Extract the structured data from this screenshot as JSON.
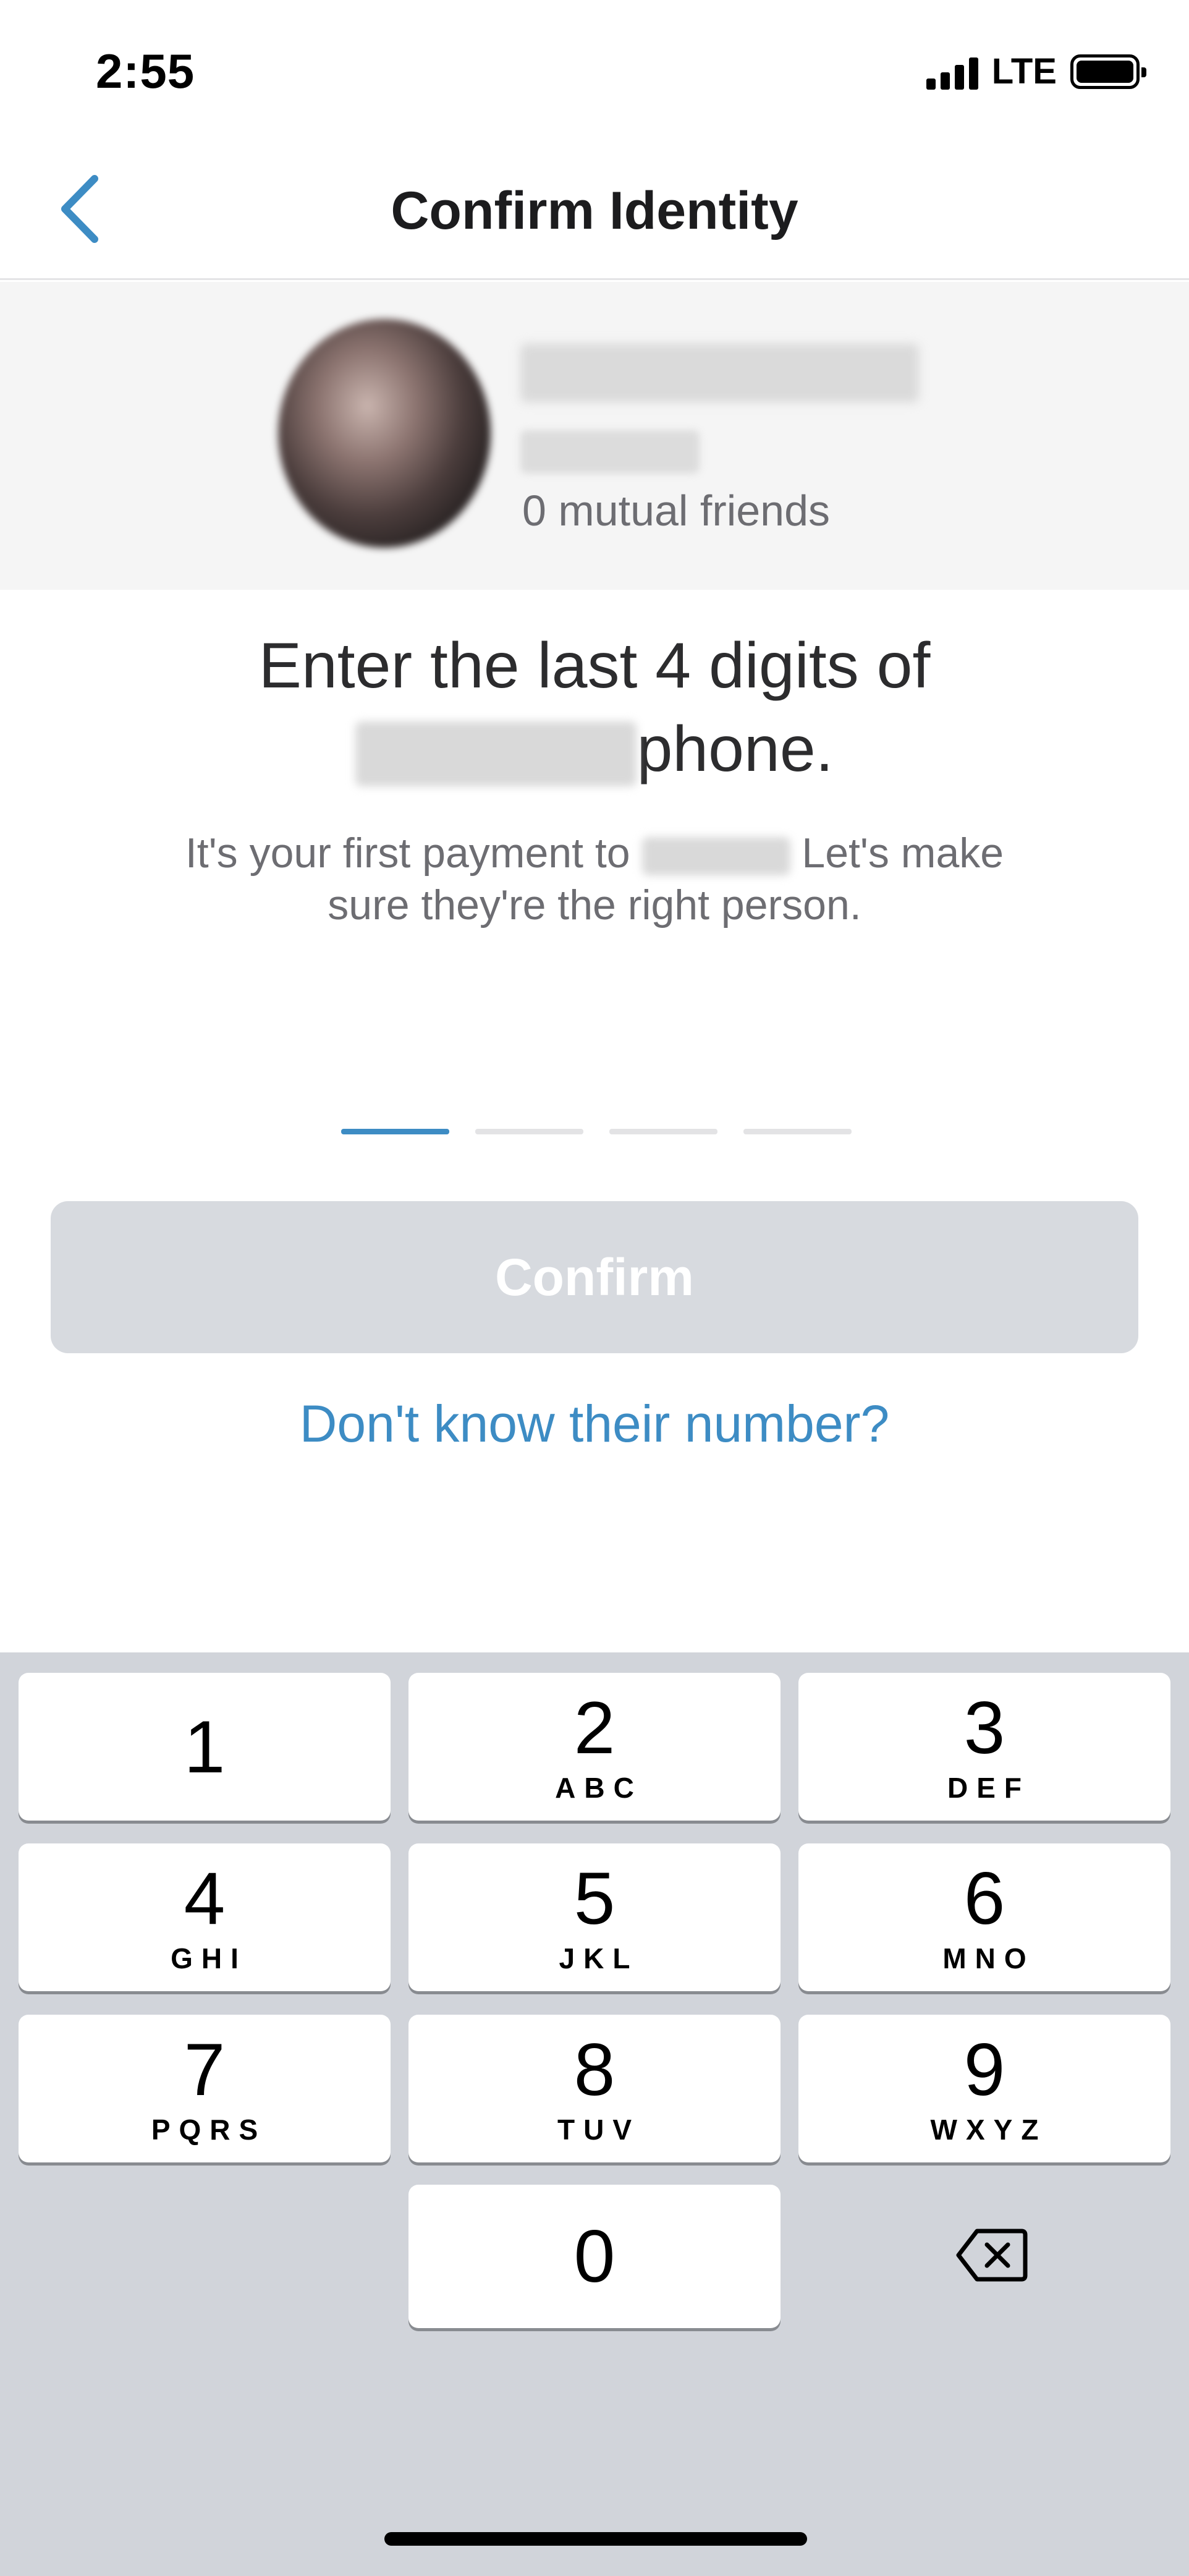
{
  "status": {
    "time": "2:55",
    "network": "LTE"
  },
  "nav": {
    "title": "Confirm Identity",
    "back_icon": "chevron-left-icon"
  },
  "recipient": {
    "mutual_friends": "0 mutual friends"
  },
  "prompt": {
    "heading_line1": "Enter the last 4 digits of",
    "heading_line2_suffix": "phone.",
    "sub_line1_prefix": "It's your first payment to",
    "sub_line1_suffix": "Let's make",
    "sub_line2": "sure they're the right person."
  },
  "pin": {
    "length": 4,
    "active_index": 0
  },
  "confirm": {
    "label": "Confirm"
  },
  "help_link": {
    "label": "Don't know their number?"
  },
  "keypad": [
    {
      "digit": "1",
      "letters": ""
    },
    {
      "digit": "2",
      "letters": "ABC"
    },
    {
      "digit": "3",
      "letters": "DEF"
    },
    {
      "digit": "4",
      "letters": "GHI"
    },
    {
      "digit": "5",
      "letters": "JKL"
    },
    {
      "digit": "6",
      "letters": "MNO"
    },
    {
      "digit": "7",
      "letters": "PQRS"
    },
    {
      "digit": "8",
      "letters": "TUV"
    },
    {
      "digit": "9",
      "letters": "WXYZ"
    },
    {
      "digit": "0",
      "letters": ""
    }
  ],
  "colors": {
    "accent": "#3d8cc4",
    "button_disabled": "#d7dadf",
    "keyboard_bg": "#d1d4da"
  }
}
